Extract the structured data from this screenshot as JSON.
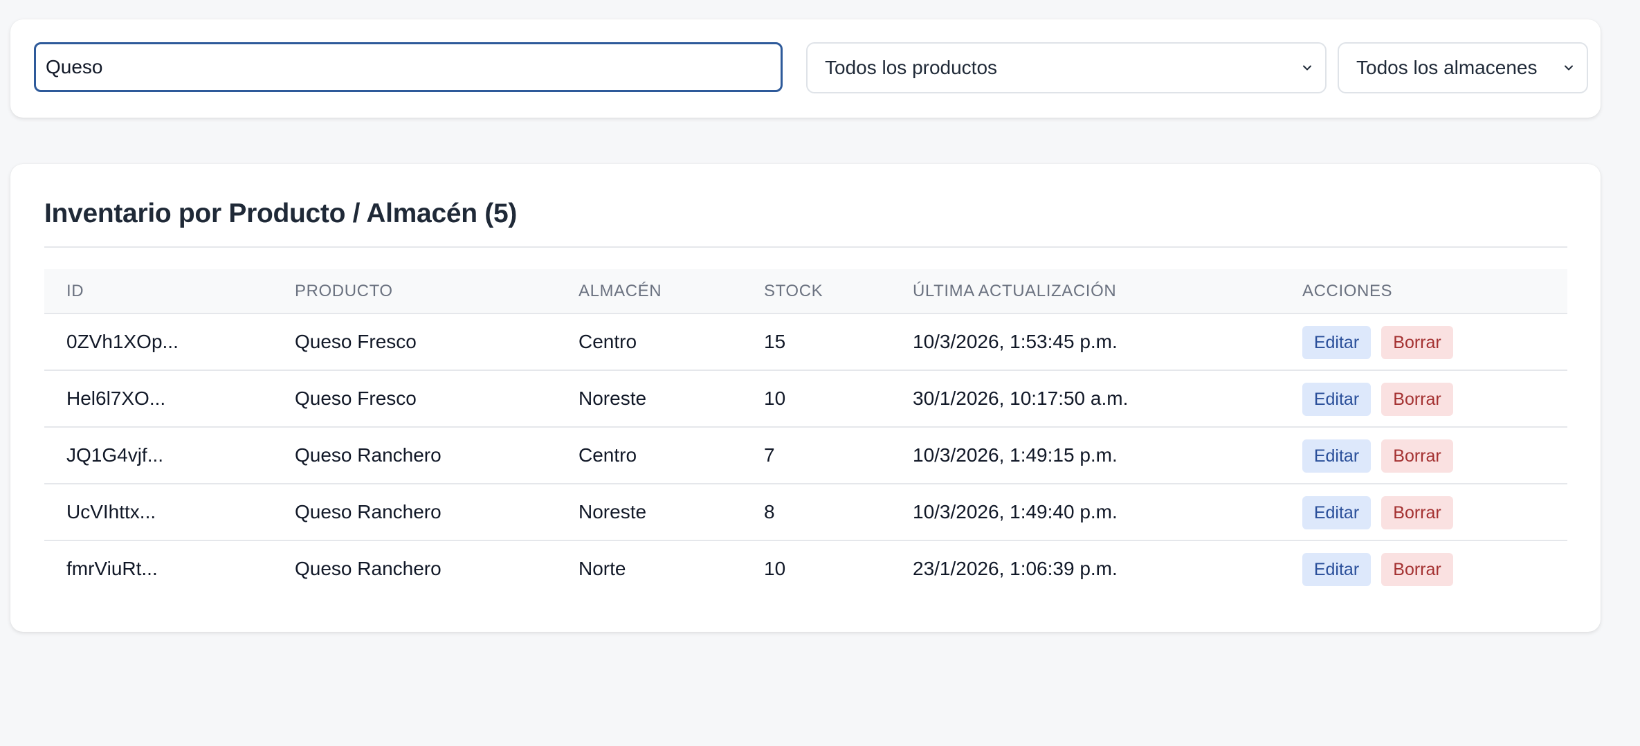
{
  "filters": {
    "search_value": "Queso",
    "product_select": "Todos los productos",
    "warehouse_select": "Todos los almacenes"
  },
  "inventory": {
    "title": "Inventario por Producto / Almacén (5)",
    "columns": [
      "ID",
      "PRODUCTO",
      "ALMACÉN",
      "STOCK",
      "ÚLTIMA ACTUALIZACIÓN",
      "ACCIONES"
    ],
    "edit_label": "Editar",
    "delete_label": "Borrar",
    "rows": [
      {
        "id": "0ZVh1XOp...",
        "product": "Queso Fresco",
        "warehouse": "Centro",
        "stock": "15",
        "updated": "10/3/2026, 1:53:45 p.m."
      },
      {
        "id": "Hel6l7XO...",
        "product": "Queso Fresco",
        "warehouse": "Noreste",
        "stock": "10",
        "updated": "30/1/2026, 10:17:50 a.m."
      },
      {
        "id": "JQ1G4vjf...",
        "product": "Queso Ranchero",
        "warehouse": "Centro",
        "stock": "7",
        "updated": "10/3/2026, 1:49:15 p.m."
      },
      {
        "id": "UcVIhttx...",
        "product": "Queso Ranchero",
        "warehouse": "Noreste",
        "stock": "8",
        "updated": "10/3/2026, 1:49:40 p.m."
      },
      {
        "id": "fmrViuRt...",
        "product": "Queso Ranchero",
        "warehouse": "Norte",
        "stock": "10",
        "updated": "23/1/2026, 1:06:39 p.m."
      }
    ]
  },
  "icons": {
    "select_arrow": "chevron-down-icon"
  },
  "colors": {
    "accent": "#2e5a9a",
    "edit_bg": "#dde8fb",
    "edit_text": "#2a4f9a",
    "delete_bg": "#fae1e1",
    "delete_text": "#a43131"
  }
}
